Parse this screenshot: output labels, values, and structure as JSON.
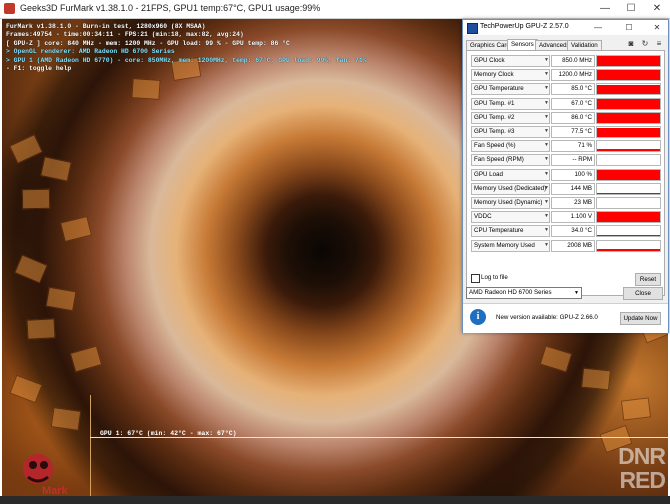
{
  "furmark": {
    "title": "Geeks3D FurMark v1.38.1.0 - 21FPS, GPU1 temp:67°C, GPU1 usage:99%",
    "overlay": [
      {
        "text": "FurMark v1.38.1.0 - Burn-in test, 1280x960 (8X MSAA)",
        "color": "white"
      },
      {
        "text": "Frames:49754 - time:00:34:11 - FPS:21 (min:18, max:82, avg:24)",
        "color": "white"
      },
      {
        "text": "[ GPU-Z ] core: 840 MHz - mem: 1200 MHz - GPU load: 99 % - GPU temp: 86 °C",
        "color": "white"
      },
      {
        "text": "> OpenGL renderer: AMD Radeon HD 6700 Series",
        "color": "cyan"
      },
      {
        "text": "> GPU 1 (AMD Radeon HD 6770) - core: 850MHz, mem: 1200MHz, temp: 67°C, GPU load: 99%, fan: 71%",
        "color": "cyan"
      },
      {
        "text": "- F1: toggle help",
        "color": "white"
      }
    ],
    "graph_label": "GPU 1: 67°C (min: 42°C - max: 67°C)",
    "logo_text": "Mark"
  },
  "watermark": {
    "line1": "DNR",
    "line2": "RED"
  },
  "gpuz": {
    "title": "TechPowerUp GPU-Z 2.57.0",
    "tabs": [
      "Graphics Card",
      "Sensors",
      "Advanced",
      "Validation"
    ],
    "active_tab": "Sensors",
    "sensors": [
      {
        "label": "GPU Clock",
        "value": "850.0 MHz",
        "level": 1.0
      },
      {
        "label": "Memory Clock",
        "value": "1200.0 MHz",
        "level": 1.0
      },
      {
        "label": "GPU Temperature",
        "value": "85.0 °C",
        "level": 0.95
      },
      {
        "label": "GPU Temp. #1",
        "value": "67.0 °C",
        "level": 0.95
      },
      {
        "label": "GPU Temp. #2",
        "value": "86.0 °C",
        "level": 0.95
      },
      {
        "label": "GPU Temp. #3",
        "value": "77.5 °C",
        "level": 0.95
      },
      {
        "label": "Fan Speed (%)",
        "value": "71 %",
        "level": 0.2
      },
      {
        "label": "Fan Speed (RPM)",
        "value": "-- RPM",
        "level": 0
      },
      {
        "label": "GPU Load",
        "value": "100 %",
        "level": 1.0
      },
      {
        "label": "Memory Used (Dedicated)",
        "value": "144 MB",
        "level": 0.12
      },
      {
        "label": "Memory Used (Dynamic)",
        "value": "23 MB",
        "level": 0.05
      },
      {
        "label": "VDDC",
        "value": "1.100 V",
        "level": 1.0
      },
      {
        "label": "CPU Temperature",
        "value": "34.0 °C",
        "level": 0.1
      },
      {
        "label": "System Memory Used",
        "value": "2008 MB",
        "level": 0.12
      }
    ],
    "log_to_file": "Log to file",
    "reset": "Reset",
    "device": "AMD Radeon HD 6700 Series",
    "close": "Close",
    "notification": "New version available: GPU-Z 2.66.0",
    "update": "Update Now",
    "accent": "#ff0000"
  }
}
